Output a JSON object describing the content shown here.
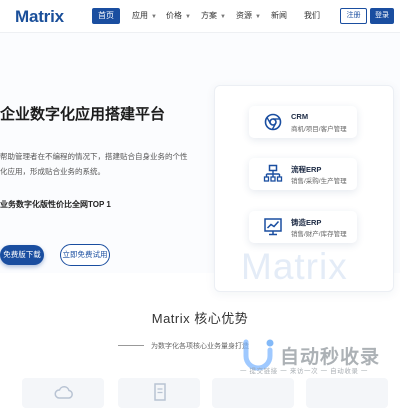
{
  "header": {
    "logo": "Matrix",
    "nav": [
      {
        "label": "首页",
        "active": true,
        "dropdown": false
      },
      {
        "label": "应用",
        "active": false,
        "dropdown": true
      },
      {
        "label": "价格",
        "active": false,
        "dropdown": true
      },
      {
        "label": "方案",
        "active": false,
        "dropdown": true
      },
      {
        "label": "资源",
        "active": false,
        "dropdown": true
      },
      {
        "label": "新闻",
        "active": false,
        "dropdown": false
      },
      {
        "label": "我们",
        "active": false,
        "dropdown": false
      }
    ],
    "register_label": "注册",
    "login_label": "登录"
  },
  "hero": {
    "title": "企业数字化应用搭建平台",
    "description": "帮助管理者在不编程的情况下，搭建贴合自身业务的个性化应用，形成贴合业务的系统。",
    "tagline": "业务数字化版性价比全网TOP 1",
    "download_label": "免费版下载",
    "trial_label": "立即免费试用",
    "watermark": "Matrix",
    "products": [
      {
        "name": "CRM",
        "desc": "商机/项目/客户管理",
        "icon": "chrome-circle-icon"
      },
      {
        "name": "流程ERP",
        "desc": "销售/采购/生产管理",
        "icon": "org-chart-icon"
      },
      {
        "name": "铸造ERP",
        "desc": "销售/财产/库存管理",
        "icon": "trend-chart-icon"
      }
    ]
  },
  "advantages": {
    "title": "Matrix 核心优势",
    "subtitle": "为数字化各项核心业务量身打造"
  },
  "overlay": {
    "brand": "自动秒收录",
    "slogan": "一 提交链接 一 来访一次 一 自动收录 一"
  },
  "colors": {
    "primary": "#1a4ea0",
    "watermark": "#e4ecf7",
    "overlay_gray": "#9aa0a6"
  }
}
